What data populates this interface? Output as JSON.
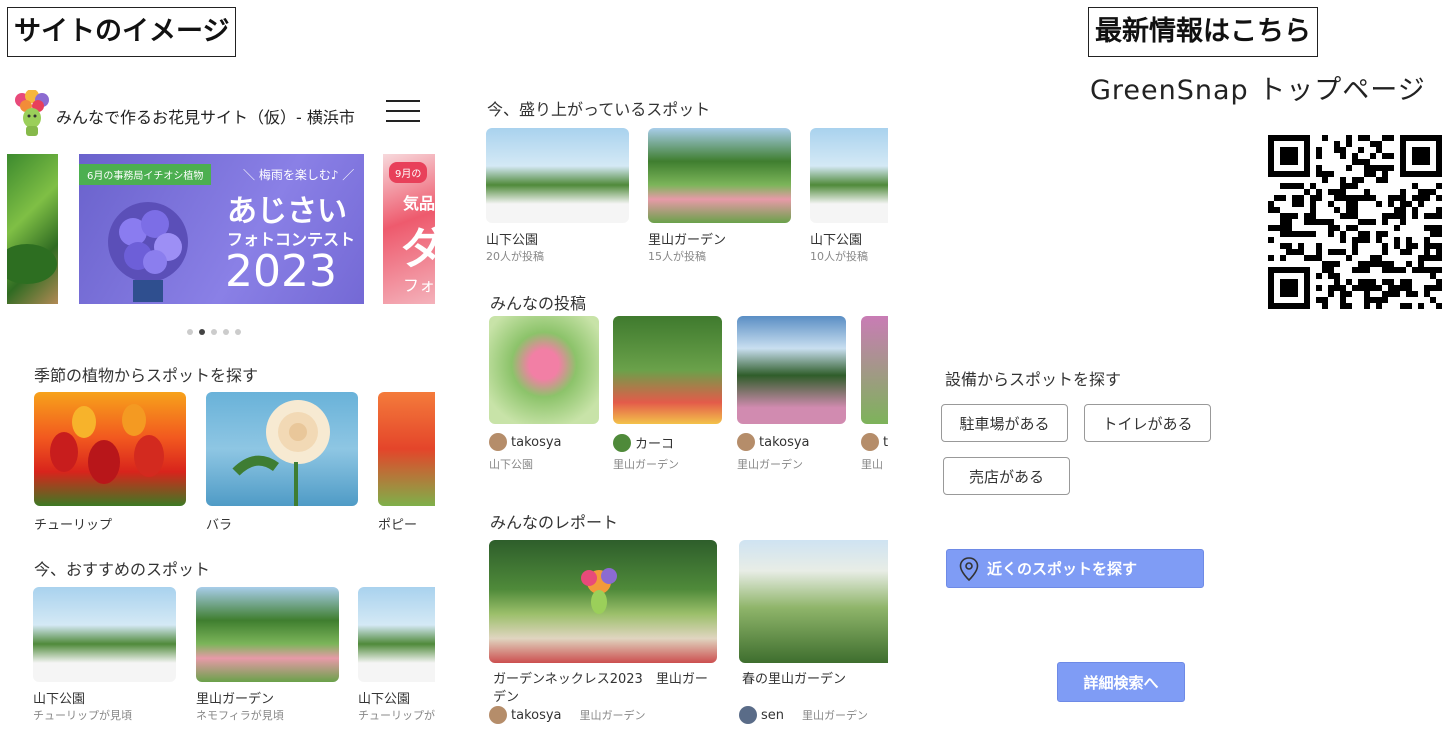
{
  "labels": {
    "site_image": "サイトのイメージ",
    "latest_info": "最新情報はこちら",
    "greensnap_top": "GreenSnap トップページ"
  },
  "header": {
    "site_title": "みんなで作るお花見サイト（仮）- 横浜市",
    "menu_icon": "hamburger-icon",
    "mascot_icon": "mascot-icon"
  },
  "banner": {
    "tag_center": "6月の事務局イチオシ植物",
    "tag_right": "9月の",
    "subtitle": "＼ 梅雨を楽しむ♪ ／",
    "title": "あじさい",
    "contest": "フォトコンテスト",
    "year": "2023",
    "right_text_1": "気品",
    "right_text_2": "ダ",
    "right_text_3": "フォ",
    "dots_total": 5,
    "dots_active": 1
  },
  "seasonal": {
    "title": "季節の植物からスポットを探す",
    "items": [
      {
        "label": "チューリップ",
        "color": "#e9452b"
      },
      {
        "label": "バラ",
        "color": "#f5e6c8"
      },
      {
        "label": "ポピー",
        "color": "#f06a3a"
      }
    ]
  },
  "recommended": {
    "title": "今、おすすめのスポット",
    "items": [
      {
        "name": "山下公園",
        "sub": "チューリップが見頃"
      },
      {
        "name": "里山ガーデン",
        "sub": "ネモフィラが見頃"
      },
      {
        "name": "山下公園",
        "sub": "チューリップが"
      }
    ]
  },
  "trending": {
    "title": "今、盛り上がっているスポット",
    "items": [
      {
        "name": "山下公園",
        "sub": "20人が投稿"
      },
      {
        "name": "里山ガーデン",
        "sub": "15人が投稿"
      },
      {
        "name": "山下公園",
        "sub": "10人が投稿"
      }
    ]
  },
  "posts": {
    "title": "みんなの投稿",
    "items": [
      {
        "user": "takosya",
        "place": "山下公園"
      },
      {
        "user": "カーコ",
        "place": "里山ガーデン"
      },
      {
        "user": "takosya",
        "place": "里山ガーデン"
      },
      {
        "user": "t",
        "place": "里山"
      }
    ]
  },
  "reports": {
    "title": "みんなのレポート",
    "items": [
      {
        "title_line1": "ガーデンネックレス2023　里山ガー",
        "title_line2": "デン",
        "user": "takosya",
        "place": "里山ガーデン"
      },
      {
        "title_line1": "春の里山ガーデン",
        "title_line2": "",
        "user": "sen",
        "place": "里山ガーデン"
      }
    ]
  },
  "facilities": {
    "title": "設備からスポットを探す",
    "chips": [
      "駐車場がある",
      "トイレがある",
      "売店がある"
    ]
  },
  "nearby_button": "近くのスポットを探す",
  "detail_search_button": "詳細検索へ",
  "colors": {
    "accent_blue": "#7f9cf5",
    "banner_purple": "#7a6fd6",
    "banner_tag_green": "#4caf50",
    "banner_tag_pink": "#e8405a"
  }
}
